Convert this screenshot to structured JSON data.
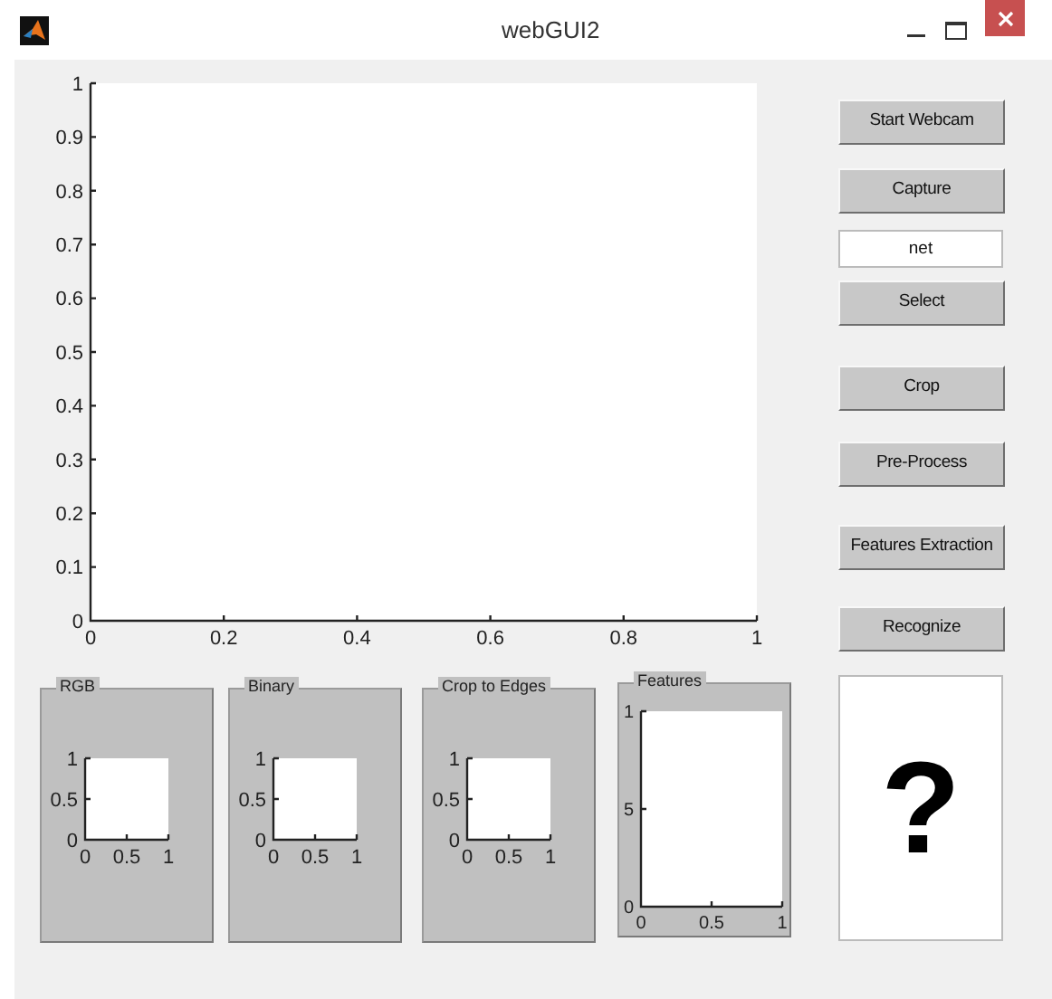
{
  "window": {
    "title": "webGUI2"
  },
  "main_axes": {
    "xticks": [
      "0",
      "0.2",
      "0.4",
      "0.6",
      "0.8",
      "1"
    ],
    "yticks": [
      "1",
      "0.9",
      "0.8",
      "0.7",
      "0.6",
      "0.5",
      "0.4",
      "0.3",
      "0.2",
      "0.1",
      "0"
    ]
  },
  "panels": [
    {
      "title": "RGB",
      "xticks": [
        "0",
        "0.5",
        "1"
      ],
      "yticks": [
        "1",
        "0.5",
        "0"
      ]
    },
    {
      "title": "Binary",
      "xticks": [
        "0",
        "0.5",
        "1"
      ],
      "yticks": [
        "1",
        "0.5",
        "0"
      ]
    },
    {
      "title": "Crop to Edges",
      "xticks": [
        "0",
        "0.5",
        "1"
      ],
      "yticks": [
        "1",
        "0.5",
        "0"
      ]
    },
    {
      "title": "Features",
      "xticks": [
        "0",
        "0.5",
        "1"
      ],
      "yticks": [
        "1",
        "5",
        "0"
      ]
    }
  ],
  "controls": [
    {
      "kind": "button",
      "label": "Start Webcam"
    },
    {
      "kind": "button",
      "label": "Capture"
    },
    {
      "kind": "field",
      "value": "net"
    },
    {
      "kind": "button",
      "label": "Select"
    },
    {
      "kind": "button",
      "label": "Crop"
    },
    {
      "kind": "button",
      "label": "Pre-Process"
    },
    {
      "kind": "button",
      "label": "Features Extraction"
    },
    {
      "kind": "button",
      "label": "Recognize"
    }
  ],
  "result": {
    "text": "?"
  }
}
